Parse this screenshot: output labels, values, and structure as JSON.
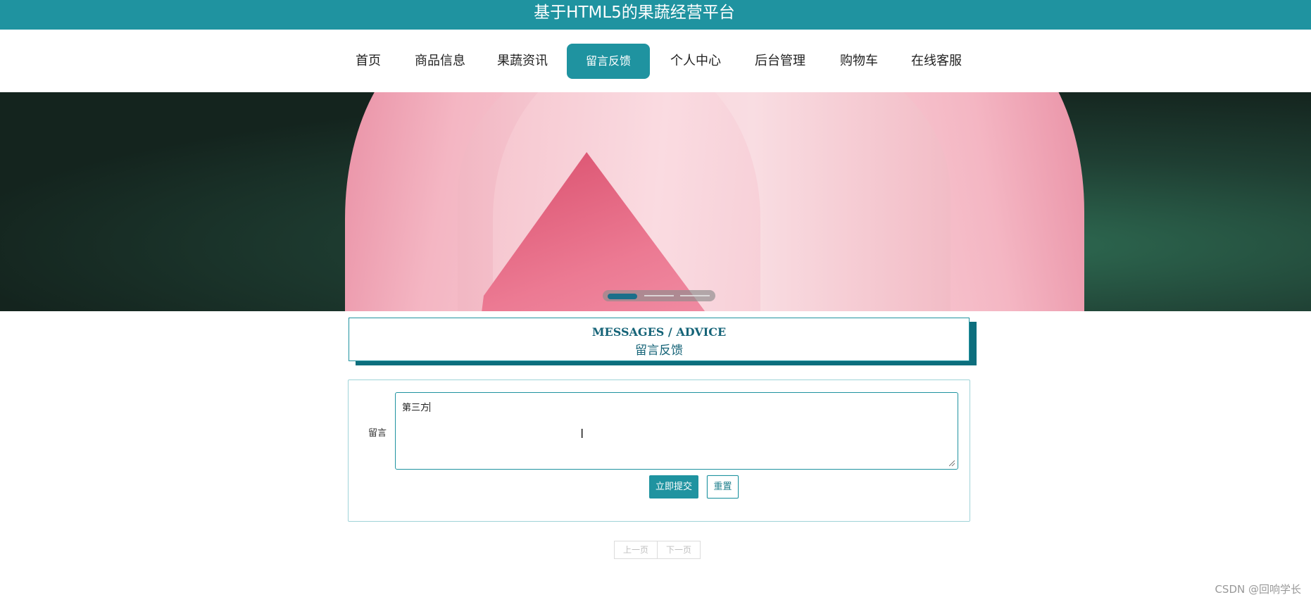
{
  "header": {
    "title": "基于HTML5的果蔬经营平台"
  },
  "nav": {
    "items": [
      {
        "label": "首页"
      },
      {
        "label": "商品信息"
      },
      {
        "label": "果蔬资讯"
      },
      {
        "label": "留言反馈",
        "active": true
      },
      {
        "label": "个人中心"
      },
      {
        "label": "后台管理"
      },
      {
        "label": "购物车"
      },
      {
        "label": "在线客服"
      }
    ]
  },
  "banner": {
    "slide_count": 3,
    "active_slide": 1
  },
  "section": {
    "title_en": "MESSAGES / ADVICE",
    "title_cn": "留言反馈"
  },
  "form": {
    "message_label": "留言",
    "message_value": "第三方",
    "submit_label": "立即提交",
    "reset_label": "重置"
  },
  "pagination": {
    "prev_label": "上一页",
    "next_label": "下一页"
  },
  "watermark": "CSDN @回响学长",
  "colors": {
    "primary": "#1f93a0",
    "heading": "#166478",
    "shadow": "#0d6e7d"
  }
}
